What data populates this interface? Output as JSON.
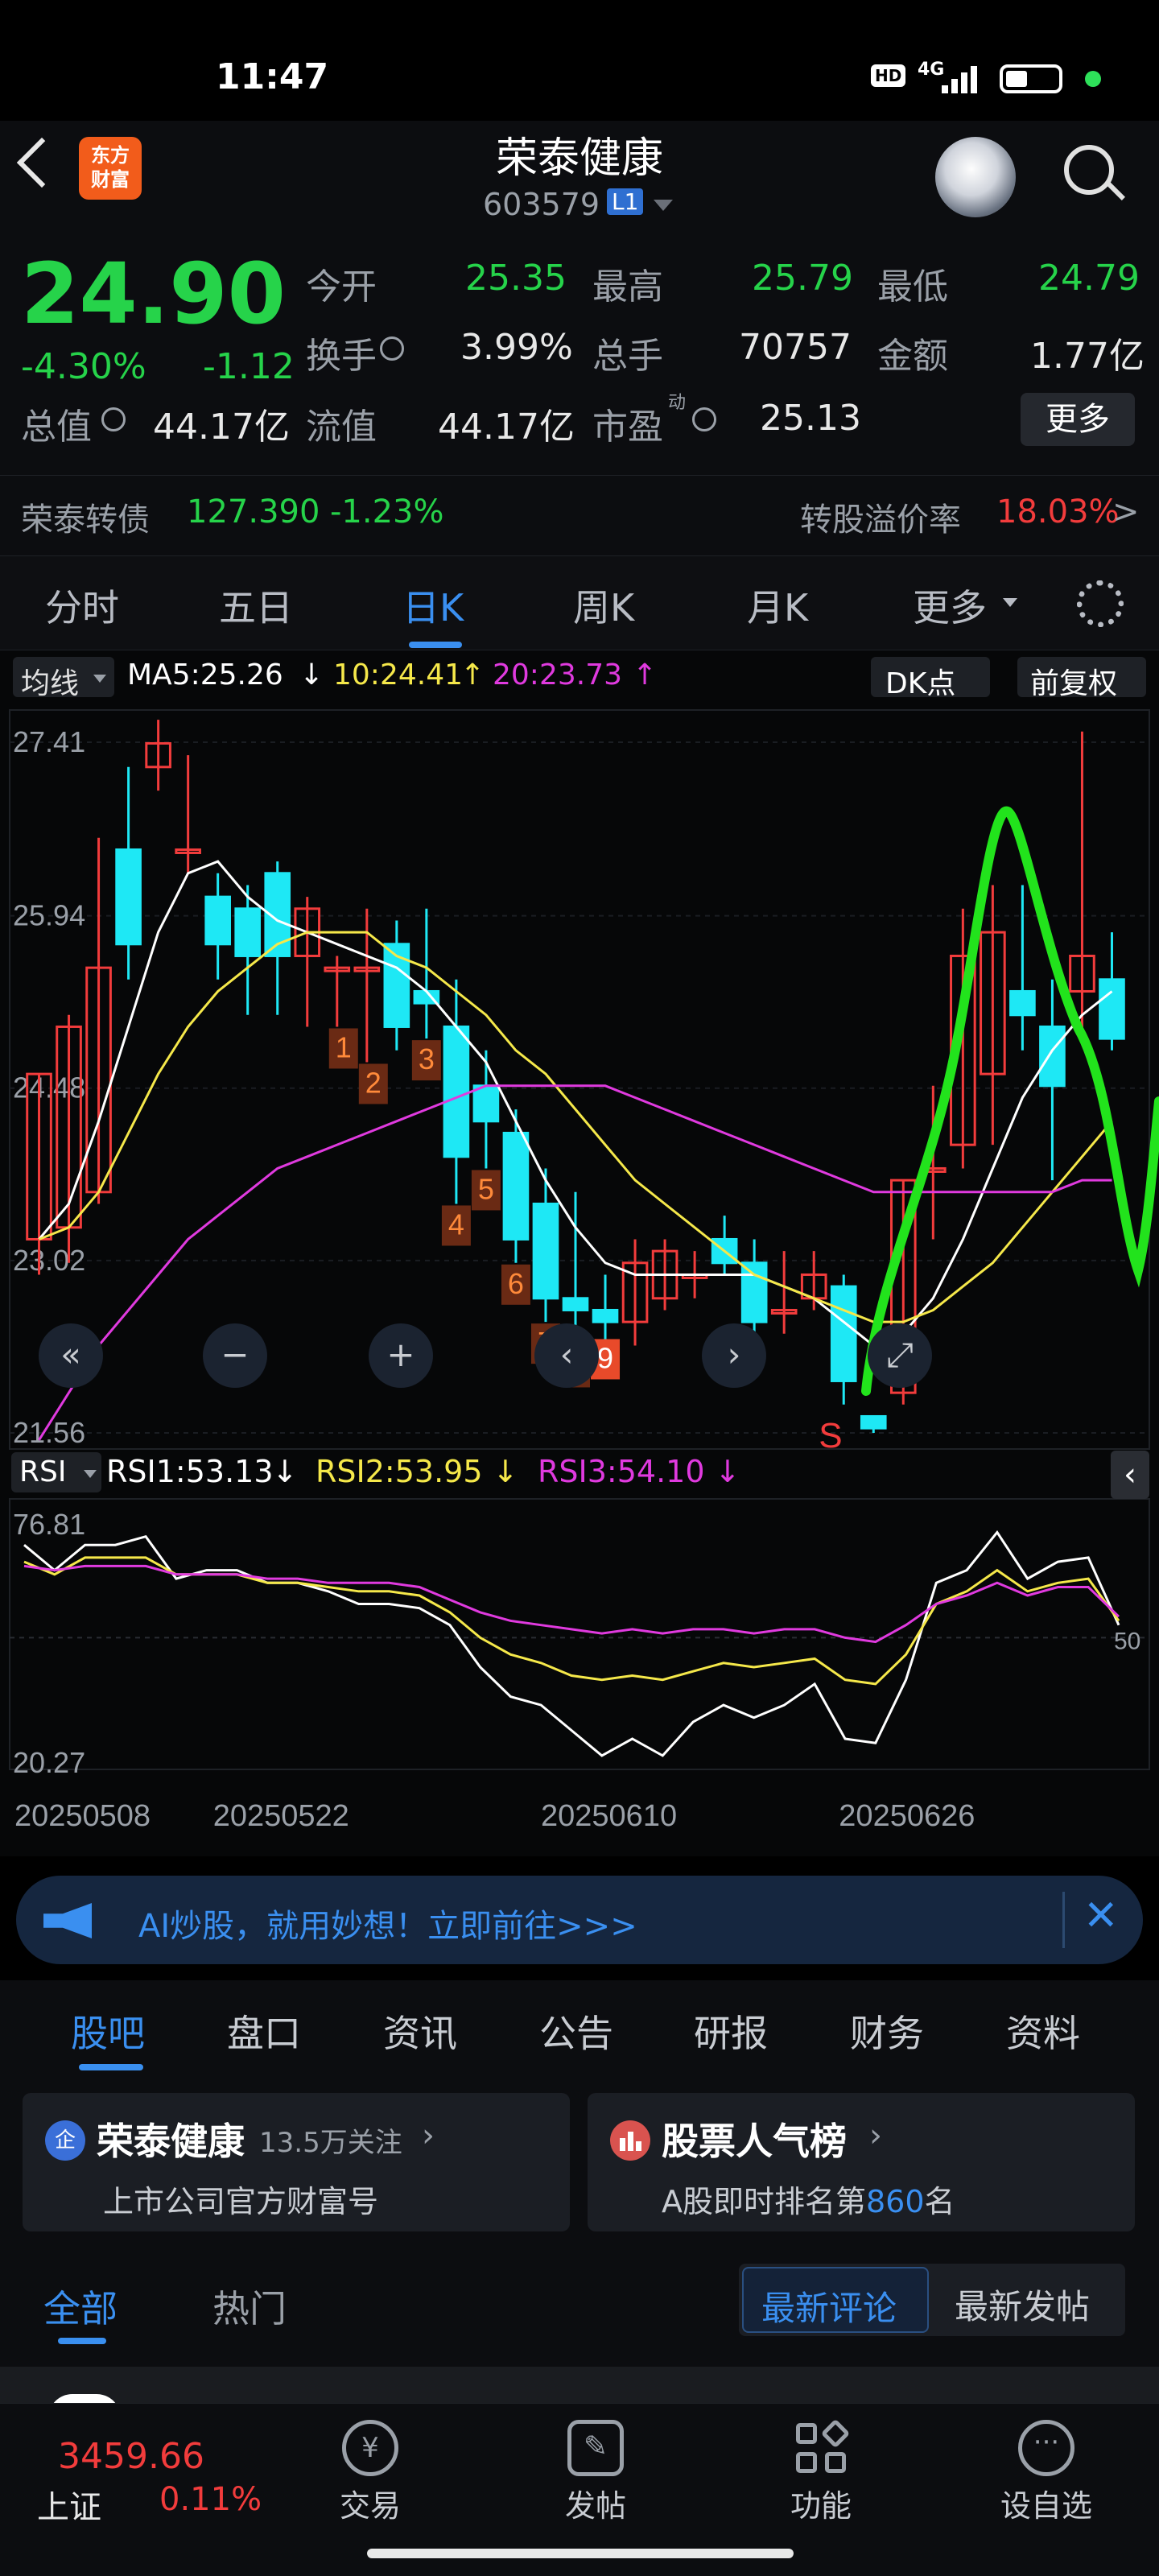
{
  "status_bar": {
    "time": "11:47",
    "network": "4G",
    "hd": "HD"
  },
  "header": {
    "title": "荣泰健康",
    "code": "603579",
    "level_badge": "L1",
    "logo_text": "东方\n财富"
  },
  "quote": {
    "price": "24.90",
    "change_pct": "-4.30%",
    "change": "-1.12",
    "open_label": "今开",
    "open": "25.35",
    "high_label": "最高",
    "high": "25.79",
    "low_label": "最低",
    "low": "24.79",
    "turnover_label": "换手",
    "turnover": "3.99%",
    "volume_label": "总手",
    "volume": "70757",
    "amount_label": "金额",
    "amount": "1.77亿",
    "mktcap_label": "总值",
    "mktcap": "44.17亿",
    "float_label": "流值",
    "float": "44.17亿",
    "pe_label": "市盈",
    "pe_sup": "动",
    "pe": "25.13",
    "more_button": "更多"
  },
  "bond": {
    "name": "荣泰转债",
    "price": "127.390",
    "change": "-1.23%",
    "premium_label": "转股溢价率",
    "premium": "18.03%",
    "chevron": ">"
  },
  "period_tabs": [
    "分时",
    "五日",
    "日K",
    "周K",
    "月K",
    "更多"
  ],
  "active_period": "日K",
  "chart_toolbar": {
    "indicator": "均线",
    "ma5": "MA5:25.26",
    "ma10": "10:24.41",
    "ma20": "20:23.73",
    "dk_button": "DK点",
    "adjust_button": "前复权"
  },
  "chart_data": [
    {
      "type": "candlestick",
      "y_ticks": [
        "27.41",
        "25.94",
        "24.48",
        "23.02",
        "21.56"
      ],
      "ylim": [
        21.56,
        27.41
      ],
      "tick_sequence_labels": [
        "1",
        "2",
        "3",
        "4",
        "5",
        "6",
        "7",
        "8",
        "9"
      ],
      "signal_label": "S",
      "candles": [
        {
          "o": 23.2,
          "c": 24.6,
          "h": 24.6,
          "l": 22.9
        },
        {
          "o": 23.3,
          "c": 25.0,
          "h": 25.1,
          "l": 23.0
        },
        {
          "o": 23.6,
          "c": 25.5,
          "h": 26.6,
          "l": 23.5
        },
        {
          "o": 26.5,
          "c": 25.7,
          "h": 27.2,
          "l": 25.4
        },
        {
          "o": 27.2,
          "c": 27.4,
          "h": 27.6,
          "l": 27.0
        },
        {
          "o": 26.5,
          "c": 26.5,
          "h": 27.3,
          "l": 26.3
        },
        {
          "o": 26.1,
          "c": 25.7,
          "h": 26.3,
          "l": 25.4
        },
        {
          "o": 26.0,
          "c": 25.6,
          "h": 26.2,
          "l": 25.1
        },
        {
          "o": 26.3,
          "c": 25.6,
          "h": 26.4,
          "l": 25.1
        },
        {
          "o": 25.6,
          "c": 26.0,
          "h": 26.1,
          "l": 25.0
        },
        {
          "o": 25.5,
          "c": 25.5,
          "h": 25.6,
          "l": 25.0
        },
        {
          "o": 25.5,
          "c": 25.5,
          "h": 26.0,
          "l": 24.7
        },
        {
          "o": 25.7,
          "c": 25.0,
          "h": 25.9,
          "l": 24.8
        },
        {
          "o": 25.3,
          "c": 25.2,
          "h": 26.0,
          "l": 24.9
        },
        {
          "o": 25.0,
          "c": 23.9,
          "h": 25.4,
          "l": 23.5
        },
        {
          "o": 24.5,
          "c": 24.2,
          "h": 24.8,
          "l": 23.8
        },
        {
          "o": 24.1,
          "c": 23.2,
          "h": 24.3,
          "l": 23.0
        },
        {
          "o": 23.5,
          "c": 22.7,
          "h": 23.8,
          "l": 22.5
        },
        {
          "o": 22.7,
          "c": 22.6,
          "h": 23.6,
          "l": 22.3
        },
        {
          "o": 22.6,
          "c": 22.5,
          "h": 22.9,
          "l": 22.3
        },
        {
          "o": 22.5,
          "c": 23.0,
          "h": 23.2,
          "l": 22.3
        },
        {
          "o": 22.7,
          "c": 23.1,
          "h": 23.2,
          "l": 22.6
        },
        {
          "o": 22.9,
          "c": 22.9,
          "h": 23.1,
          "l": 22.7
        },
        {
          "o": 23.2,
          "c": 23.0,
          "h": 23.4,
          "l": 22.9
        },
        {
          "o": 23.0,
          "c": 22.5,
          "h": 23.2,
          "l": 22.4
        },
        {
          "o": 22.6,
          "c": 22.6,
          "h": 23.1,
          "l": 22.4
        },
        {
          "o": 22.7,
          "c": 22.9,
          "h": 23.1,
          "l": 22.6
        },
        {
          "o": 22.8,
          "c": 22.0,
          "h": 22.9,
          "l": 21.8
        },
        {
          "o": 21.7,
          "c": 21.6,
          "h": 21.7,
          "l": 21.56
        },
        {
          "o": 21.9,
          "c": 23.7,
          "h": 23.7,
          "l": 21.8
        },
        {
          "o": 23.8,
          "c": 23.8,
          "h": 24.5,
          "l": 23.2
        },
        {
          "o": 24.0,
          "c": 25.6,
          "h": 26.0,
          "l": 23.8
        },
        {
          "o": 24.6,
          "c": 25.8,
          "h": 26.2,
          "l": 24.0
        },
        {
          "o": 25.3,
          "c": 25.1,
          "h": 26.2,
          "l": 24.8
        },
        {
          "o": 25.0,
          "c": 24.5,
          "h": 25.4,
          "l": 23.7
        },
        {
          "o": 25.3,
          "c": 25.6,
          "h": 27.5,
          "l": 24.9
        },
        {
          "o": 25.4,
          "c": 24.9,
          "h": 25.8,
          "l": 24.8
        }
      ],
      "ma5": [
        23.2,
        23.5,
        24.2,
        25.0,
        25.8,
        26.3,
        26.4,
        26.1,
        25.9,
        25.8,
        25.7,
        25.6,
        25.5,
        25.3,
        25.0,
        24.7,
        24.2,
        23.7,
        23.3,
        23.0,
        22.9,
        22.9,
        22.9,
        22.9,
        22.9,
        22.8,
        22.7,
        22.5,
        22.3,
        22.4,
        22.7,
        23.2,
        23.8,
        24.4,
        24.8,
        25.1,
        25.3
      ],
      "ma10": [
        23.2,
        23.3,
        23.6,
        24.1,
        24.6,
        25.0,
        25.3,
        25.5,
        25.7,
        25.8,
        25.8,
        25.8,
        25.6,
        25.5,
        25.3,
        25.1,
        24.8,
        24.6,
        24.3,
        24.0,
        23.7,
        23.5,
        23.3,
        23.1,
        22.9,
        22.8,
        22.7,
        22.6,
        22.5,
        22.5,
        22.6,
        22.8,
        23.0,
        23.3,
        23.6,
        23.9,
        24.2
      ],
      "ma20": [
        21.5,
        21.9,
        22.3,
        22.6,
        22.9,
        23.2,
        23.4,
        23.6,
        23.8,
        23.9,
        24.0,
        24.1,
        24.2,
        24.3,
        24.4,
        24.5,
        24.5,
        24.5,
        24.5,
        24.5,
        24.4,
        24.3,
        24.2,
        24.1,
        24.0,
        23.9,
        23.8,
        23.7,
        23.6,
        23.6,
        23.6,
        23.6,
        23.6,
        23.6,
        23.6,
        23.7,
        23.7
      ],
      "x_ticks": [
        "20250508",
        "20250522",
        "20250610",
        "20250626"
      ]
    },
    {
      "type": "line",
      "title": "RSI",
      "series": [
        {
          "name": "RSI1:53.13",
          "color": "#ffffff",
          "values": [
            72,
            66,
            72,
            72,
            74,
            64,
            66,
            66,
            63,
            63,
            61,
            58,
            58,
            57,
            53,
            43,
            36,
            34,
            28,
            22,
            26,
            22,
            30,
            34,
            31,
            34,
            39,
            26,
            25,
            40,
            63,
            66,
            75,
            64,
            68,
            69,
            53
          ]
        },
        {
          "name": "RSI2:53.95",
          "color": "#f5e84a",
          "values": [
            68,
            65,
            69,
            69,
            69,
            65,
            65,
            65,
            63,
            63,
            62,
            61,
            61,
            60,
            56,
            50,
            46,
            44,
            41,
            40,
            41,
            40,
            42,
            44,
            43,
            44,
            45,
            40,
            39,
            46,
            58,
            61,
            66,
            61,
            63,
            64,
            54
          ]
        },
        {
          "name": "RSI3:54.10",
          "color": "#e03adf",
          "values": [
            67,
            66,
            67,
            67,
            67,
            65,
            65,
            65,
            64,
            64,
            63,
            63,
            63,
            62,
            59,
            56,
            54,
            53,
            52,
            51,
            52,
            51,
            52,
            52,
            51,
            52,
            52,
            50,
            49,
            53,
            58,
            60,
            63,
            60,
            62,
            62,
            55
          ]
        }
      ],
      "ylim": [
        20.27,
        76.81
      ],
      "y_ticks": [
        "76.81",
        "50",
        "20.27"
      ]
    }
  ],
  "ad_banner": {
    "text": "AI炒股，就用妙想！立即前往>>>"
  },
  "forum_tabs": [
    "股吧",
    "盘口",
    "资讯",
    "公告",
    "研报",
    "财务",
    "资料"
  ],
  "active_forum_tab": "股吧",
  "cards": [
    {
      "badge": "企",
      "title": "荣泰健康",
      "followers": "13.5万关注",
      "subtitle": "上市公司官方财富号"
    },
    {
      "title": "股票人气榜",
      "subtitle_prefix": "A股即时排名第",
      "rank": "860",
      "subtitle_suffix": "名"
    }
  ],
  "sub_tabs": [
    "全部",
    "热门"
  ],
  "active_sub_tab": "全部",
  "sort_buttons": [
    "最新评论",
    "最新发帖"
  ],
  "bottom_nav": {
    "index_value": "3459.66",
    "index_name": "上证",
    "index_change": "0.11%",
    "items": [
      "交易",
      "发帖",
      "功能",
      "设自选"
    ]
  },
  "colors": {
    "up": "#f23c3c",
    "down": "#26d34a",
    "candle_down": "#1ee8f5",
    "accent": "#3a8ff0"
  }
}
